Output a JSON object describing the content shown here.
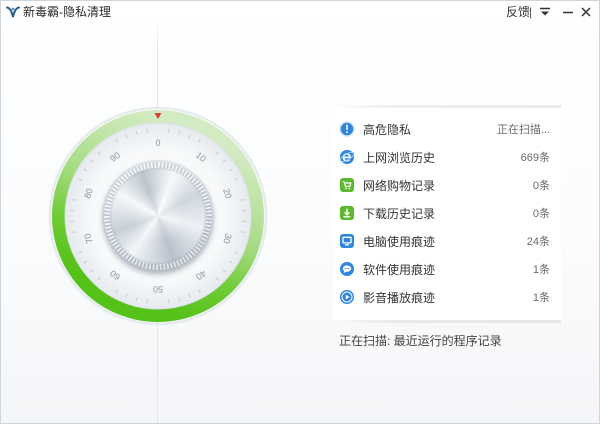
{
  "window": {
    "title": "新毒霸-隐私清理",
    "feedback_label": "反馈",
    "separator": "|",
    "logo_icon": "duba-logo-icon",
    "menu_icon": "menu-dropdown-icon",
    "minimize_icon": "minimize-icon",
    "close_icon": "close-icon"
  },
  "dial": {
    "labels": [
      "0",
      "10",
      "20",
      "30",
      "40",
      "50",
      "60",
      "70",
      "80",
      "90"
    ],
    "pointer_color": "#d8402f",
    "ring_colors": {
      "light": "#d3ebc3",
      "bright": "#55c21a"
    }
  },
  "scan_items": [
    {
      "icon": "warning-icon",
      "label": "高危隐私",
      "status": "正在扫描...",
      "color": "#2f86df"
    },
    {
      "icon": "ie-browser-icon",
      "label": "上网浏览历史",
      "status": "669条",
      "color": "#2f86df"
    },
    {
      "icon": "shopping-cart-icon",
      "label": "网络购物记录",
      "status": "0条",
      "color": "#5cb82c"
    },
    {
      "icon": "download-icon",
      "label": "下载历史记录",
      "status": "0条",
      "color": "#5cb82c"
    },
    {
      "icon": "computer-icon",
      "label": "电脑使用痕迹",
      "status": "24条",
      "color": "#2f86df"
    },
    {
      "icon": "software-icon",
      "label": "软件使用痕迹",
      "status": "1条",
      "color": "#2f86df"
    },
    {
      "icon": "media-play-icon",
      "label": "影音播放痕迹",
      "status": "1条",
      "color": "#2f86df"
    }
  ],
  "status_bar": {
    "text": "正在扫描: 最近运行的程序记录"
  }
}
